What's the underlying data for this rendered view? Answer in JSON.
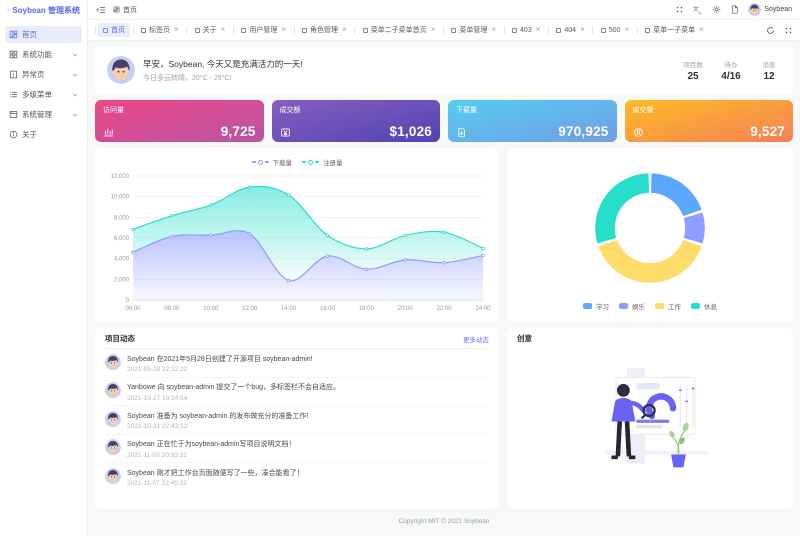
{
  "app": {
    "logo_title": "Soybean 管理系统"
  },
  "theme": {
    "primary": "#5b6af0",
    "content_bg": "#f6f9f8"
  },
  "header": {
    "breadcrumb_home": "首页",
    "user_name": "Soybean"
  },
  "sidebar": {
    "items": [
      {
        "label": "首页",
        "active": true
      },
      {
        "label": "系统功能",
        "expandable": true
      },
      {
        "label": "异常页",
        "expandable": true
      },
      {
        "label": "多级菜单",
        "expandable": true
      },
      {
        "label": "系统管理",
        "expandable": true
      },
      {
        "label": "关于"
      }
    ]
  },
  "tabbar": {
    "tabs": [
      {
        "label": "首页",
        "active": true
      },
      {
        "label": "标签页",
        "closable": true
      },
      {
        "label": "关于",
        "closable": true
      },
      {
        "label": "用户管理",
        "closable": true
      },
      {
        "label": "角色管理",
        "closable": true
      },
      {
        "label": "菜单二子菜单首页",
        "closable": true
      },
      {
        "label": "菜单管理",
        "closable": true
      },
      {
        "label": "403",
        "closable": true
      },
      {
        "label": "404",
        "closable": true
      },
      {
        "label": "500",
        "closable": true
      },
      {
        "label": "菜单一子菜单",
        "closable": true
      }
    ]
  },
  "greeting": {
    "title": "早安，Soybean, 今天又是充满活力的一天!",
    "subtitle": "今日多云转晴，20°C - 25°C!",
    "stats": [
      {
        "label": "项目数",
        "value": "25"
      },
      {
        "label": "待办",
        "value": "4/16"
      },
      {
        "label": "消息",
        "value": "12"
      }
    ]
  },
  "stat_cards": [
    {
      "label": "访问量",
      "value": "9,725",
      "icon": "bar-chart-icon",
      "gradient_start": "#ec4786",
      "gradient_end": "#b955a4"
    },
    {
      "label": "成交额",
      "value": "$1,026",
      "icon": "money-icon",
      "gradient_start": "#865ec0",
      "gradient_end": "#5144b4"
    },
    {
      "label": "下载量",
      "value": "970,925",
      "icon": "download-icon",
      "gradient_start": "#56cdf3",
      "gradient_end": "#719de3"
    },
    {
      "label": "成交量",
      "value": "9,527",
      "icon": "registered-icon",
      "gradient_start": "#fcbc25",
      "gradient_end": "#f68057"
    }
  ],
  "chart_data": [
    {
      "type": "area",
      "stacked": true,
      "x": [
        "06:00",
        "08:00",
        "10:00",
        "12:00",
        "14:00",
        "16:00",
        "18:00",
        "20:00",
        "22:00",
        "24:00"
      ],
      "series": [
        {
          "name": "下载量",
          "color": "#8e9dff",
          "values": [
            4623,
            6145,
            6268,
            6411,
            1890,
            4251,
            2978,
            3880,
            3606,
            4311
          ]
        },
        {
          "name": "注册量",
          "color": "#26deca",
          "values": [
            2208,
            2016,
            2916,
            4512,
            8281,
            2008,
            1963,
            2367,
            2956,
            678
          ]
        }
      ],
      "ylim": [
        0,
        12000
      ],
      "y_ticks": [
        "0",
        "2,000",
        "4,000",
        "6,000",
        "8,000",
        "10,000",
        "12,000"
      ],
      "legend_position": "top",
      "grid": true
    },
    {
      "type": "pie",
      "donut": true,
      "categories": [
        "学习",
        "娱乐",
        "工作",
        "休息"
      ],
      "values": [
        20,
        10,
        40,
        30
      ],
      "colors": [
        "#5da8ff",
        "#8e9dff",
        "#fedc69",
        "#26deca"
      ],
      "legend_position": "bottom"
    }
  ],
  "news": {
    "title": "项目动态",
    "more_label": "更多动态",
    "items": [
      {
        "text": "Soybean 在2021年5月28日创建了开源项目 soybean-admin!",
        "time": "2021-05-28 22:22:22"
      },
      {
        "text": "Yanbowe 向 soybean-admin 提交了一个bug，多标签栏不会自适应。",
        "time": "2021-10-27 10:24:54"
      },
      {
        "text": "Soybean 准备为 soybean-admin 的发布做充分的准备工作!",
        "time": "2021-10-31 22:43:12"
      },
      {
        "text": "Soybean 正在忙于为soybean-admin写项目说明文档！",
        "time": "2021-11-03 20:33:31"
      },
      {
        "text": "Soybean 刚才把工作台页面随便写了一些，凑合能看了！",
        "time": "2021-11-07 22:45:32"
      }
    ]
  },
  "creative": {
    "title": "创意"
  },
  "footer": {
    "copyright": "Copyright MIT © 2021 Soybean"
  }
}
